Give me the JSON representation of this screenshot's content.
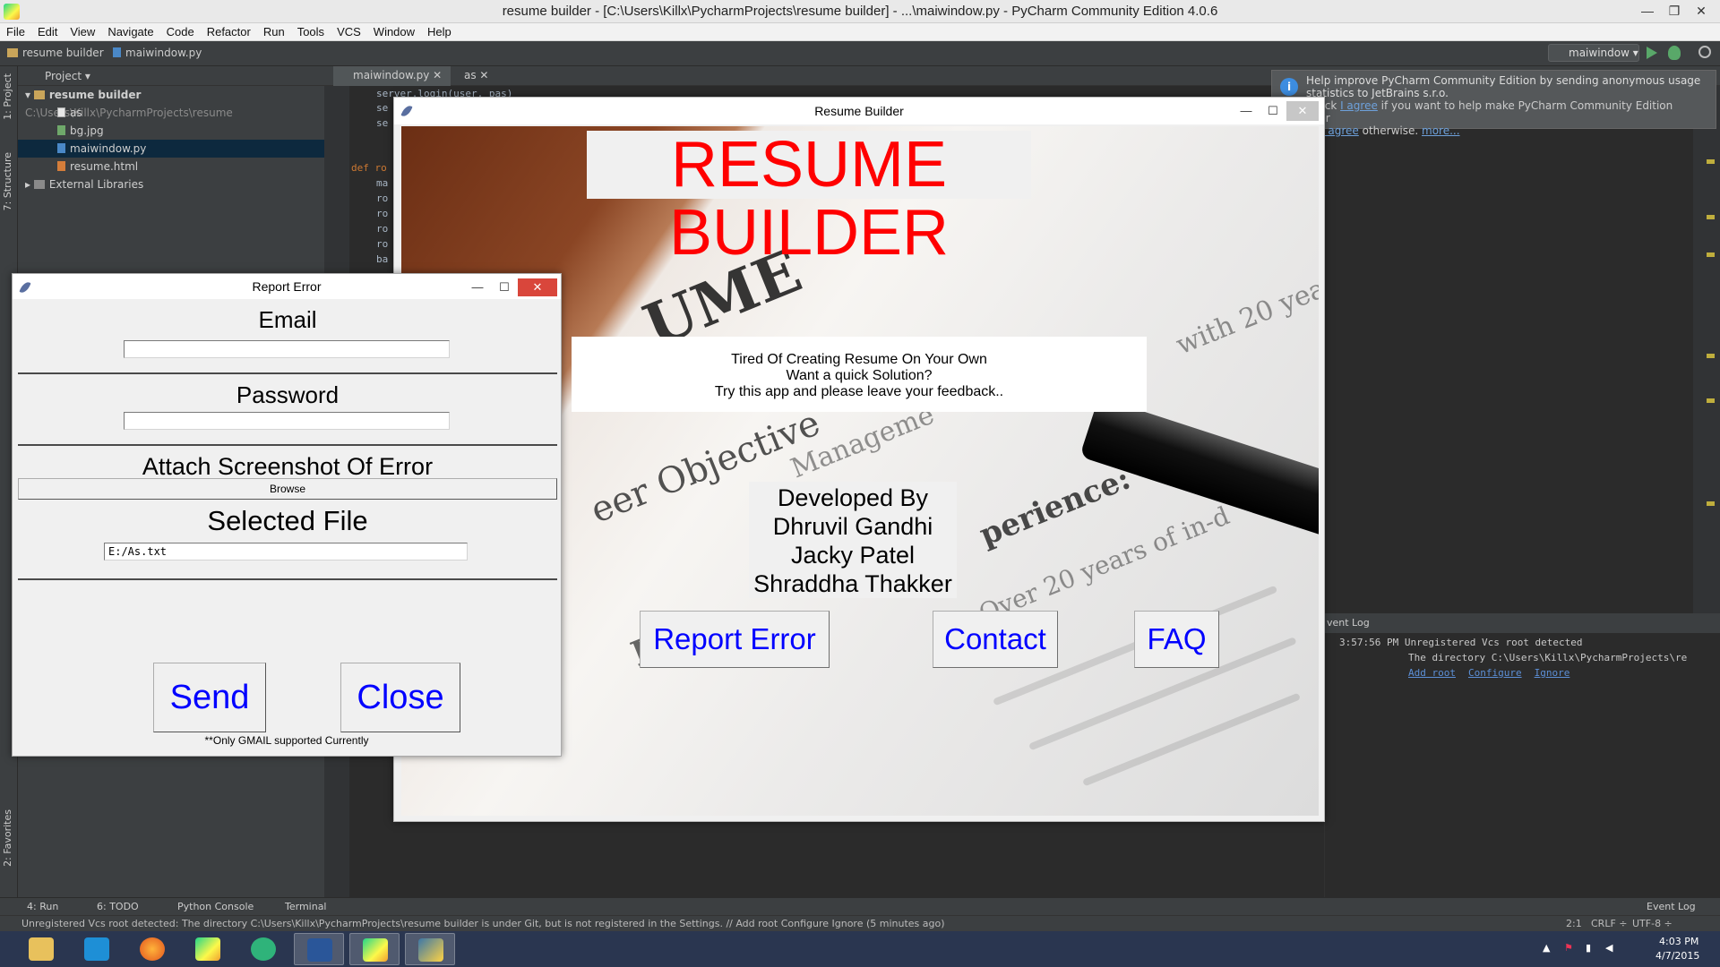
{
  "ide": {
    "window_title": "resume builder - [C:\\Users\\Killx\\PycharmProjects\\resume builder] - ...\\maiwindow.py - PyCharm Community Edition 4.0.6",
    "menu": [
      "File",
      "Edit",
      "View",
      "Navigate",
      "Code",
      "Refactor",
      "Run",
      "Tools",
      "VCS",
      "Window",
      "Help"
    ],
    "breadcrumb": [
      "resume builder",
      "maiwindow.py"
    ],
    "run_config": "maiwindow",
    "project_panel": {
      "header": "Project",
      "root": "resume builder",
      "root_path": "C:\\Users\\Killx\\PycharmProjects\\resume",
      "items": [
        "as",
        "bg.jpg",
        "maiwindow.py",
        "resume.html"
      ],
      "external": "External Libraries"
    },
    "editor_tabs": [
      "maiwindow.py",
      "as"
    ],
    "code_lines": [
      "server.login(user, pas)",
      "se",
      "se",
      "def ro",
      "ma",
      "ro",
      "ro",
      "ro",
      "ro",
      "ba"
    ],
    "side_tabs": {
      "project": "1: Project",
      "structure": "7: Structure",
      "favorites": "2: Favorites"
    },
    "notification": {
      "line1": "Help improve PyCharm Community Edition by sending anonymous usage statistics to JetBrains s.r.o.",
      "line2_pre": "se click ",
      "agree": "I agree",
      "line2_post": " if you want to help make PyCharm Community Edition better",
      "disagree": "don't agree",
      "line3_post": " otherwise. ",
      "more": "more..."
    },
    "event_log": {
      "header": "vent Log",
      "time": "3:57:56 PM",
      "message": "Unregistered Vcs root detected",
      "detail": "The directory C:\\Users\\Killx\\PycharmProjects\\re",
      "links": [
        "Add root",
        "Configure",
        "Ignore"
      ]
    },
    "bottom_tools": [
      "4: Run",
      "6: TODO",
      "Python Console",
      "Terminal",
      "Event Log"
    ],
    "status": {
      "message": "Unregistered Vcs root detected: The directory C:\\Users\\Killx\\PycharmProjects\\resume builder is under Git, but is not registered in the Settings. // Add root  Configure  Ignore (5 minutes ago)",
      "position": "2:1",
      "line_sep": "CRLF ÷",
      "encoding": "UTF-8 ÷"
    }
  },
  "resume_builder": {
    "title": "Resume Builder",
    "heading": "RESUME BUILDER",
    "tagline": [
      "Tired Of Creating Resume On Your Own",
      "Want a quick Solution?",
      "Try this app and please leave your feedback.."
    ],
    "developed_by": [
      "Developed By",
      "Dhruvil Gandhi",
      "Jacky Patel",
      "Shraddha Thakker"
    ],
    "buttons": {
      "report": "Report  Error",
      "contact": "Contact",
      "faq": "FAQ"
    },
    "bg_text": {
      "me": "UME",
      "objective": "eer Objective",
      "management": "Manageme",
      "experience": "perience:",
      "years": "with 20 years",
      "profe": "Profe",
      "over": "Over 20 years of in-d"
    }
  },
  "report_error": {
    "title": "Report Error",
    "email_label": "Email",
    "email_value": "",
    "password_label": "Password",
    "password_value": "",
    "attach_label": "Attach Screenshot Of Error",
    "browse": "Browse",
    "selected_label": "Selected File",
    "selected_value": "E:/As.txt",
    "send": "Send",
    "close": "Close",
    "note": "**Only GMAIL supported Currently"
  },
  "taskbar": {
    "time": "4:03 PM",
    "date": "4/7/2015",
    "apps": [
      "file-explorer",
      "outlook",
      "firefox",
      "pycharm",
      "atom",
      "word",
      "pycharm-2",
      "python-tk"
    ]
  }
}
